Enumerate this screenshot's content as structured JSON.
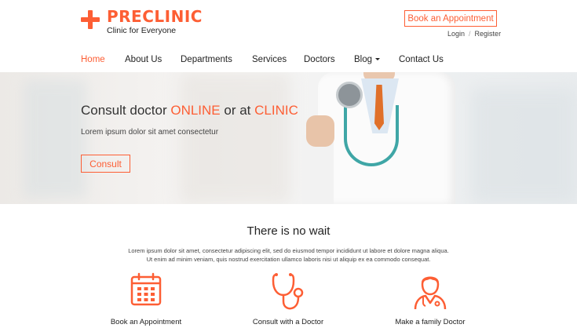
{
  "brand": {
    "name": "PRECLINIC",
    "tagline": "Clinic for Everyone",
    "accent_color": "#fd5e34"
  },
  "header": {
    "appointment_button": "Book an Appointment",
    "login": "Login",
    "separator": "/",
    "register": "Register"
  },
  "nav": {
    "items": [
      "Home",
      "About Us",
      "Departments",
      "Services",
      "Doctors",
      "Blog",
      "Contact Us"
    ],
    "active": "Home"
  },
  "hero": {
    "title_part1": "Consult doctor ",
    "title_highlight1": "ONLINE",
    "title_part2": " or at ",
    "title_highlight2": "CLINIC",
    "subtitle": "Lorem ipsum dolor sit amet consectetur",
    "button": "Consult"
  },
  "section": {
    "title": "There is no wait",
    "line1": "Lorem ipsum dolor sit amet, consectetur adipiscing elit, sed do eiusmod tempor incididunt ut labore et dolore magna aliqua.",
    "line2": "Ut enim ad minim veniam, quis nostrud exercitation ullamco laboris nisi ut aliquip ex ea commodo consequat."
  },
  "features": [
    {
      "label": "Book an Appointment",
      "icon": "calendar-icon"
    },
    {
      "label": "Consult with a Doctor",
      "icon": "stethoscope-icon"
    },
    {
      "label": "Make a family Doctor",
      "icon": "doctor-icon"
    }
  ]
}
